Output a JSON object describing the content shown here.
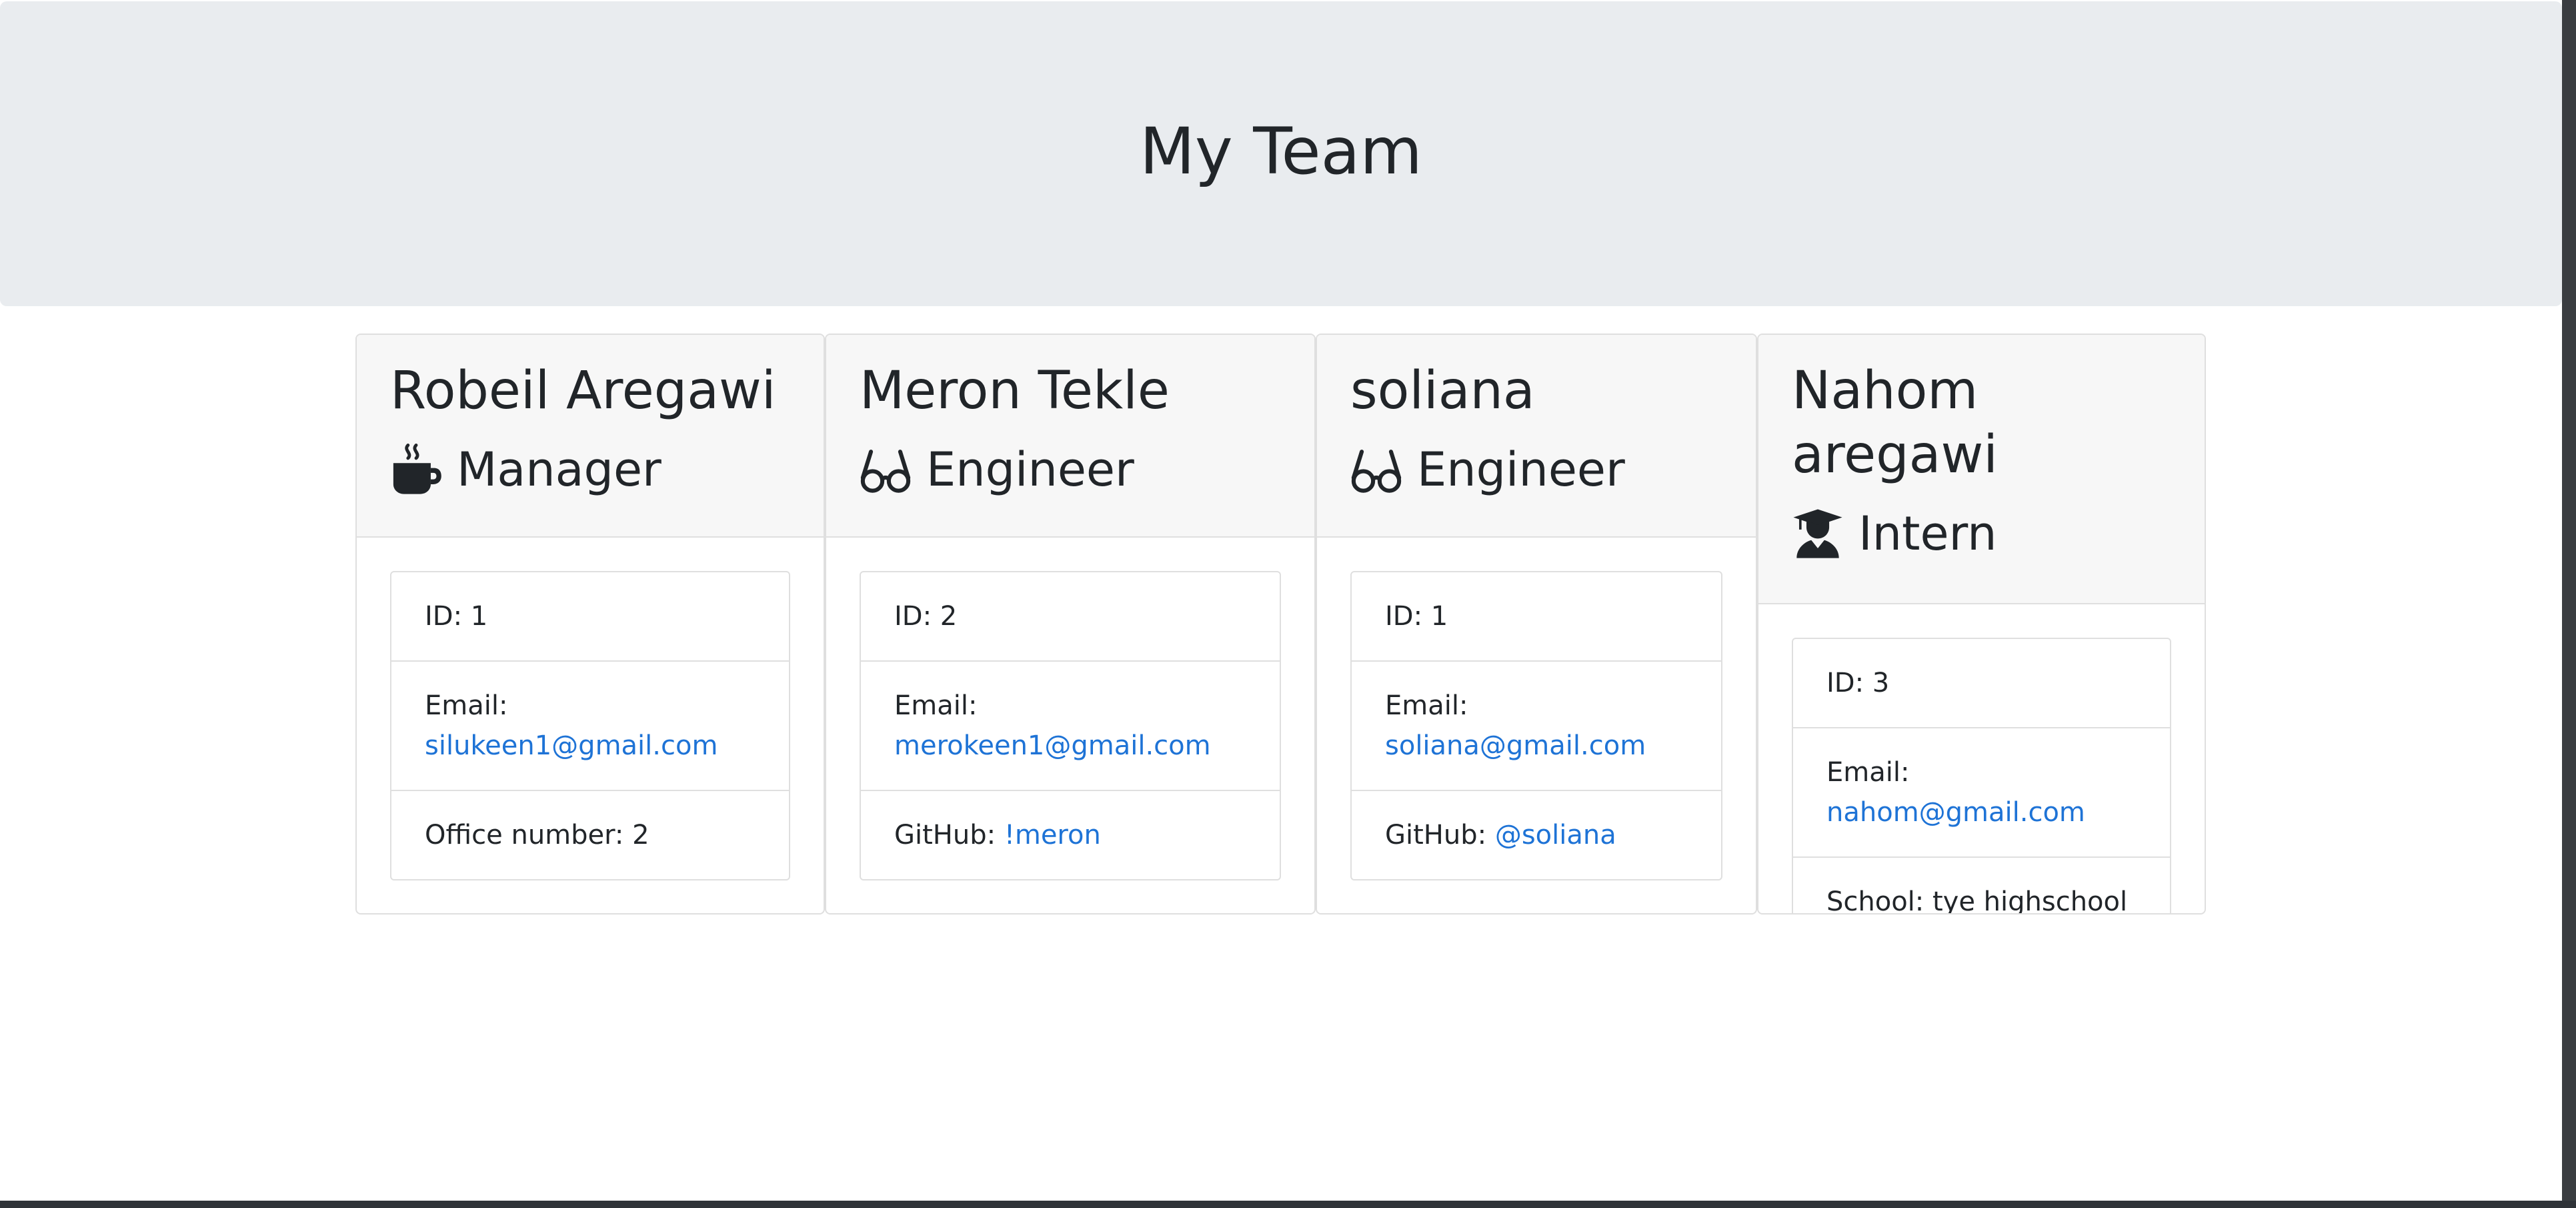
{
  "header": {
    "title": "My Team"
  },
  "team": [
    {
      "name": "Robeil Aregawi",
      "role": "Manager",
      "role_icon": "coffee-icon",
      "id_label": "ID: 1",
      "email_label": "Email:",
      "email": "silukeen1@gmail.com",
      "extra_label": "Office number: 2",
      "extra_link": ""
    },
    {
      "name": "Meron Tekle",
      "role": "Engineer",
      "role_icon": "glasses-icon",
      "id_label": "ID: 2",
      "email_label": "Email:",
      "email": "merokeen1@gmail.com",
      "extra_label": "GitHub:",
      "extra_link": "!meron"
    },
    {
      "name": "soliana",
      "role": "Engineer",
      "role_icon": "glasses-icon",
      "id_label": "ID: 1",
      "email_label": "Email:",
      "email": "soliana@gmail.com",
      "extra_label": "GitHub:",
      "extra_link": "@soliana"
    },
    {
      "name": "Nahom aregawi",
      "role": "Intern",
      "role_icon": "graduate-icon",
      "id_label": "ID: 3",
      "email_label": "Email:",
      "email": "nahom@gmail.com",
      "extra_label": "School: tye highschool",
      "extra_link": ""
    }
  ],
  "colors": {
    "hero_bg": "#e9ecef",
    "link": "#1e73d6",
    "text": "#212529"
  }
}
